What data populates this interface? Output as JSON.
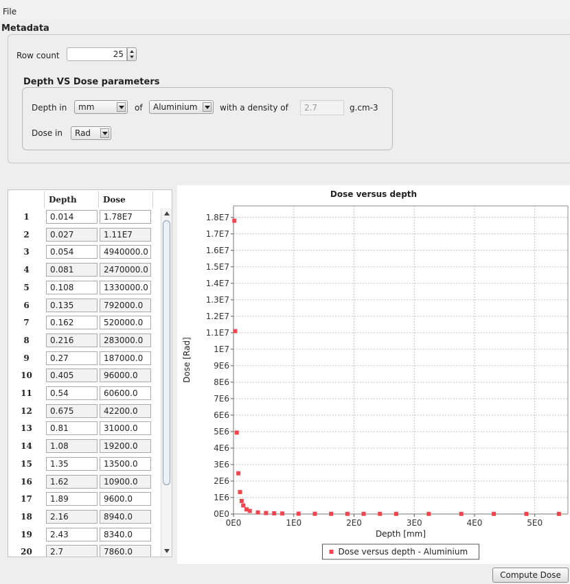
{
  "menu": {
    "file": "File"
  },
  "metadata": {
    "title": "Metadata",
    "row_count_label": "Row count",
    "row_count_value": "25",
    "params": {
      "title": "Depth VS Dose parameters",
      "depth_in_label": "Depth in",
      "depth_unit": "mm",
      "of_label": "of",
      "material": "Aluminium",
      "density_label": "with a density of",
      "density_value": "2.7",
      "density_unit": "g.cm-3",
      "dose_in_label": "Dose in",
      "dose_unit": "Rad"
    }
  },
  "table": {
    "headers": {
      "depth": "Depth",
      "dose": "Dose"
    },
    "rows": [
      {
        "n": "1",
        "depth": "0.014",
        "dose": "1.78E7"
      },
      {
        "n": "2",
        "depth": "0.027",
        "dose": "1.11E7"
      },
      {
        "n": "3",
        "depth": "0.054",
        "dose": "4940000.0"
      },
      {
        "n": "4",
        "depth": "0.081",
        "dose": "2470000.0"
      },
      {
        "n": "5",
        "depth": "0.108",
        "dose": "1330000.0"
      },
      {
        "n": "6",
        "depth": "0.135",
        "dose": "792000.0"
      },
      {
        "n": "7",
        "depth": "0.162",
        "dose": "520000.0"
      },
      {
        "n": "8",
        "depth": "0.216",
        "dose": "283000.0"
      },
      {
        "n": "9",
        "depth": "0.27",
        "dose": "187000.0"
      },
      {
        "n": "10",
        "depth": "0.405",
        "dose": "96000.0"
      },
      {
        "n": "11",
        "depth": "0.54",
        "dose": "60600.0"
      },
      {
        "n": "12",
        "depth": "0.675",
        "dose": "42200.0"
      },
      {
        "n": "13",
        "depth": "0.81",
        "dose": "31000.0"
      },
      {
        "n": "14",
        "depth": "1.08",
        "dose": "19200.0"
      },
      {
        "n": "15",
        "depth": "1.35",
        "dose": "13500.0"
      },
      {
        "n": "16",
        "depth": "1.62",
        "dose": "10900.0"
      },
      {
        "n": "17",
        "depth": "1.89",
        "dose": "9600.0"
      },
      {
        "n": "18",
        "depth": "2.16",
        "dose": "8940.0"
      },
      {
        "n": "19",
        "depth": "2.43",
        "dose": "8340.0"
      },
      {
        "n": "20",
        "depth": "2.7",
        "dose": "7860.0"
      }
    ]
  },
  "compute_button": "Compute Dose",
  "chart_data": {
    "type": "scatter",
    "title": "Dose versus depth",
    "xlabel": "Depth [mm]",
    "ylabel": "Dose [Rad]",
    "xlim": [
      0,
      5.55
    ],
    "ylim": [
      0,
      18700000
    ],
    "x_ticks": [
      {
        "v": 0,
        "label": "0E0"
      },
      {
        "v": 1,
        "label": "1E0"
      },
      {
        "v": 2,
        "label": "2E0"
      },
      {
        "v": 3,
        "label": "3E0"
      },
      {
        "v": 4,
        "label": "4E0"
      },
      {
        "v": 5,
        "label": "5E0"
      }
    ],
    "y_ticks": [
      {
        "v": 0,
        "label": "0E0"
      },
      {
        "v": 1000000,
        "label": "1E6"
      },
      {
        "v": 2000000,
        "label": "2E6"
      },
      {
        "v": 3000000,
        "label": "3E6"
      },
      {
        "v": 4000000,
        "label": "4E6"
      },
      {
        "v": 5000000,
        "label": "5E6"
      },
      {
        "v": 6000000,
        "label": "6E6"
      },
      {
        "v": 7000000,
        "label": "7E6"
      },
      {
        "v": 8000000,
        "label": "8E6"
      },
      {
        "v": 9000000,
        "label": "9E6"
      },
      {
        "v": 10000000,
        "label": "1E7"
      },
      {
        "v": 11000000,
        "label": "1.1E7"
      },
      {
        "v": 12000000,
        "label": "1.2E7"
      },
      {
        "v": 13000000,
        "label": "1.3E7"
      },
      {
        "v": 14000000,
        "label": "1.4E7"
      },
      {
        "v": 15000000,
        "label": "1.5E7"
      },
      {
        "v": 16000000,
        "label": "1.6E7"
      },
      {
        "v": 17000000,
        "label": "1.7E7"
      },
      {
        "v": 18000000,
        "label": "1.8E7"
      }
    ],
    "grid": true,
    "legend_position": "bottom",
    "series": [
      {
        "name": "Dose versus depth - Aluminium",
        "color": "#f0454f",
        "x": [
          0.014,
          0.027,
          0.054,
          0.081,
          0.108,
          0.135,
          0.162,
          0.216,
          0.27,
          0.405,
          0.54,
          0.675,
          0.81,
          1.08,
          1.35,
          1.62,
          1.89,
          2.16,
          2.43,
          2.7,
          3.24,
          3.78,
          4.32,
          4.86,
          5.4
        ],
        "y": [
          17800000,
          11100000,
          4940000,
          2470000,
          1330000,
          792000,
          520000,
          283000,
          187000,
          96000,
          60600,
          42200,
          31000,
          19200,
          13500,
          10900,
          9600,
          8940,
          8340,
          7860,
          7000,
          6500,
          6000,
          5700,
          5400
        ]
      }
    ]
  }
}
